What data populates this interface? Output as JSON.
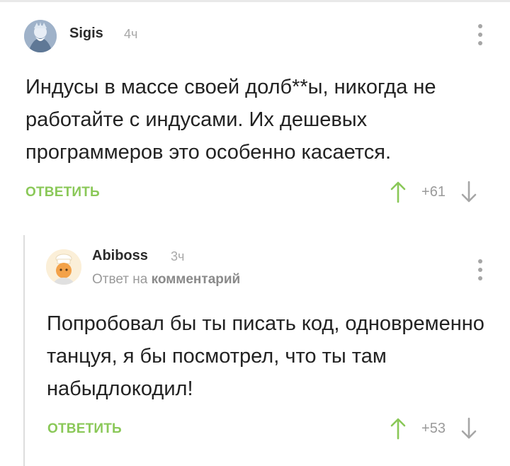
{
  "comments": [
    {
      "author": "Sigis",
      "time": "4ч",
      "text": "Индусы в массе своей долб**ы, никогда не работайте с индусами. Их дешевых программеров это особенно касается.",
      "reply_label": "ОТВЕТИТЬ",
      "score": "+61"
    },
    {
      "author": "Abiboss",
      "time": "3ч",
      "reply_prefix": "Ответ на",
      "reply_link": "комментарий",
      "text": "Попробовал бы ты писать код, одновременно танцуя, я бы посмотрел, что ты там набыдлокодил!",
      "reply_label": "ОТВЕТИТЬ",
      "score": "+53"
    }
  ],
  "colors": {
    "accent_green": "#8ac858",
    "muted_text": "#9a9a9a",
    "thread_line": "#dddddd"
  },
  "icons": [
    "avatar-image",
    "more-vertical-icon",
    "arrow-up-icon",
    "arrow-down-icon"
  ]
}
